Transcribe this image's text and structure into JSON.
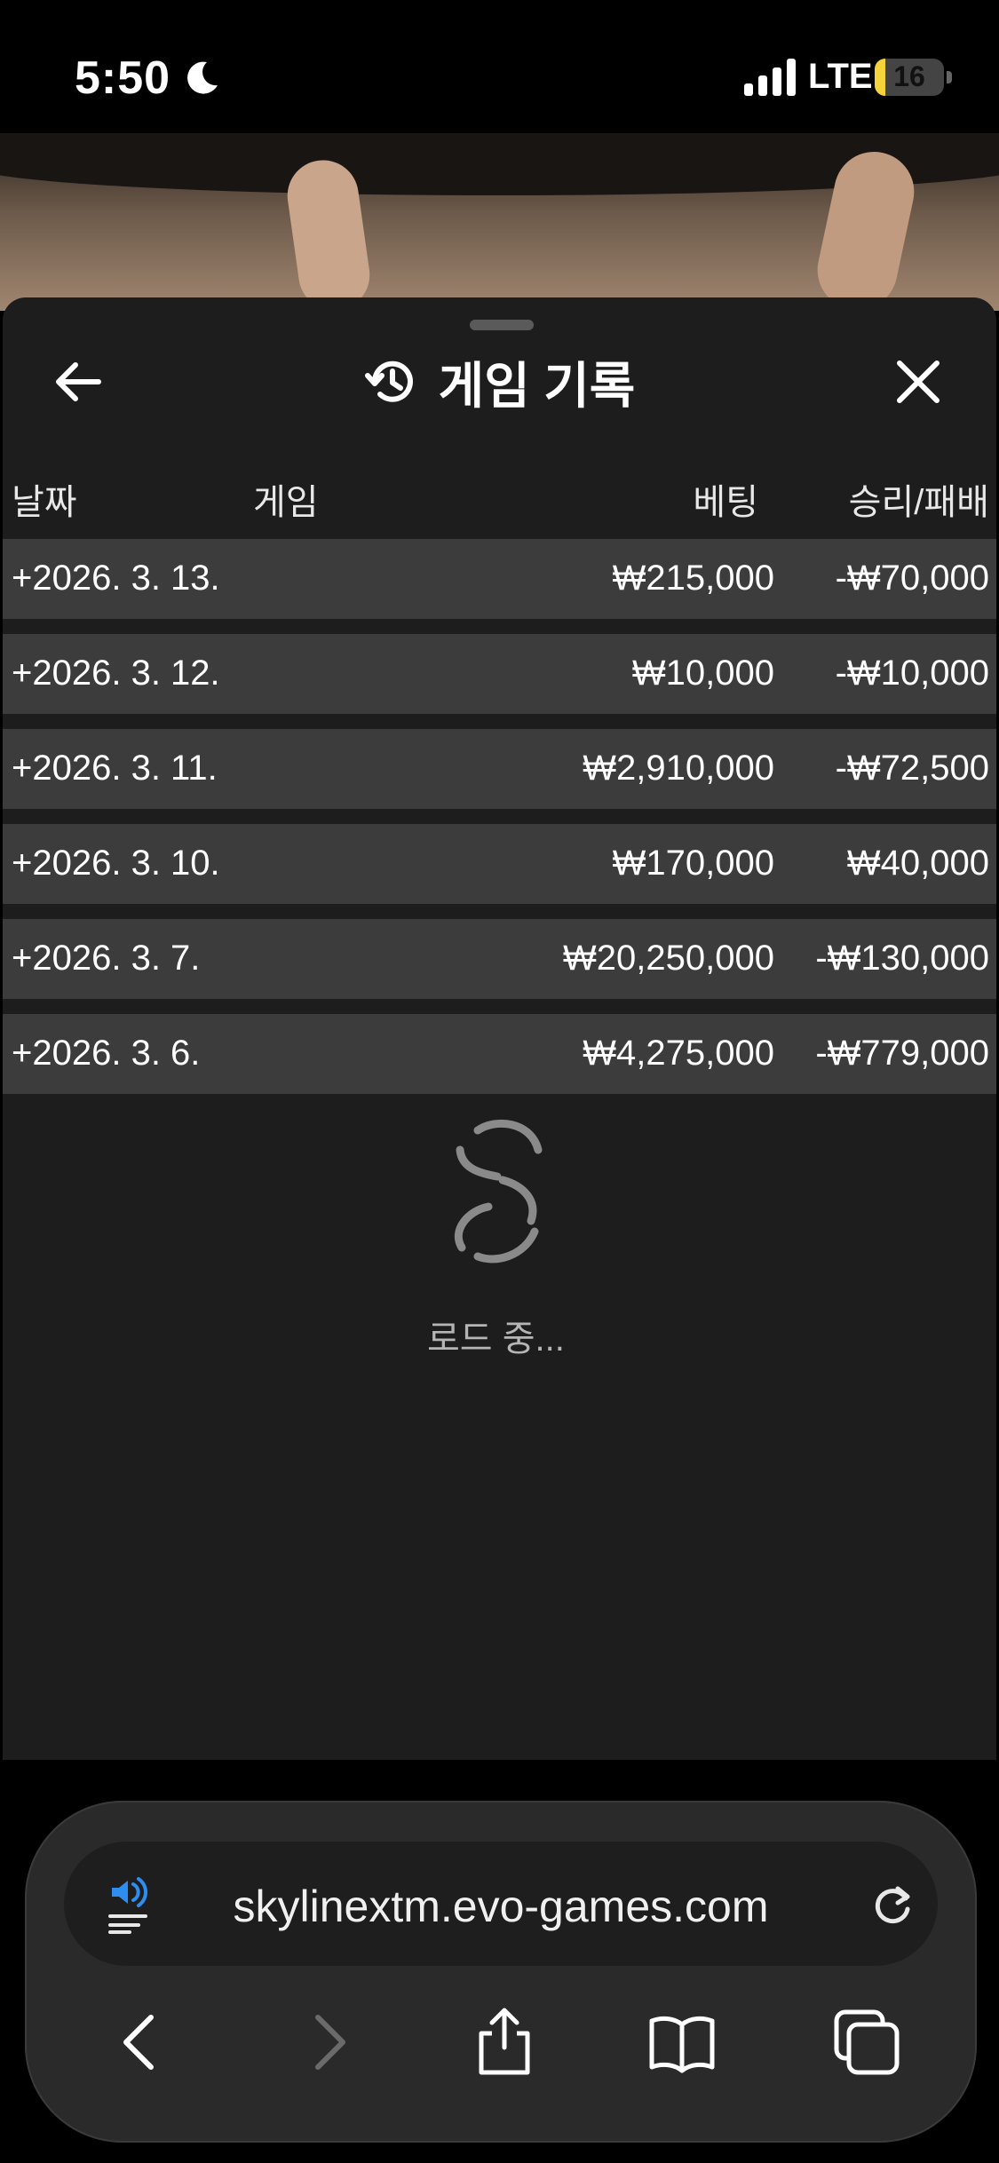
{
  "status_bar": {
    "time": "5:50",
    "network": "LTE",
    "battery": "16",
    "battery_level": 0.16,
    "icons": [
      "moon-icon",
      "signal-icon",
      "battery-icon"
    ]
  },
  "panel": {
    "title": "게임 기록",
    "icons": {
      "back": "arrow-left-icon",
      "history": "history-icon",
      "close": "close-icon"
    },
    "columns": {
      "date": "날짜",
      "game": "게임",
      "bet": "베팅",
      "winloss": "승리/패배"
    },
    "rows": [
      {
        "date": "+2026. 3. 13.",
        "bet": "₩215,000",
        "winloss": "-₩70,000"
      },
      {
        "date": "+2026. 3. 12.",
        "bet": "₩10,000",
        "winloss": "-₩10,000"
      },
      {
        "date": "+2026. 3. 11.",
        "bet": "₩2,910,000",
        "winloss": "-₩72,500"
      },
      {
        "date": "+2026. 3. 10.",
        "bet": "₩170,000",
        "winloss": "₩40,000"
      },
      {
        "date": "+2026. 3. 7.",
        "bet": "₩20,250,000",
        "winloss": "-₩130,000"
      },
      {
        "date": "+2026. 3. 6.",
        "bet": "₩4,275,000",
        "winloss": "-₩779,000"
      }
    ],
    "loading_text": "로드 중..."
  },
  "browser": {
    "url": "skylinextm.evo-games.com",
    "accent": "#2e8ef0",
    "icons": [
      "reader-audio-icon",
      "reload-icon",
      "back-icon",
      "forward-icon",
      "share-icon",
      "bookmarks-icon",
      "tabs-icon"
    ]
  }
}
